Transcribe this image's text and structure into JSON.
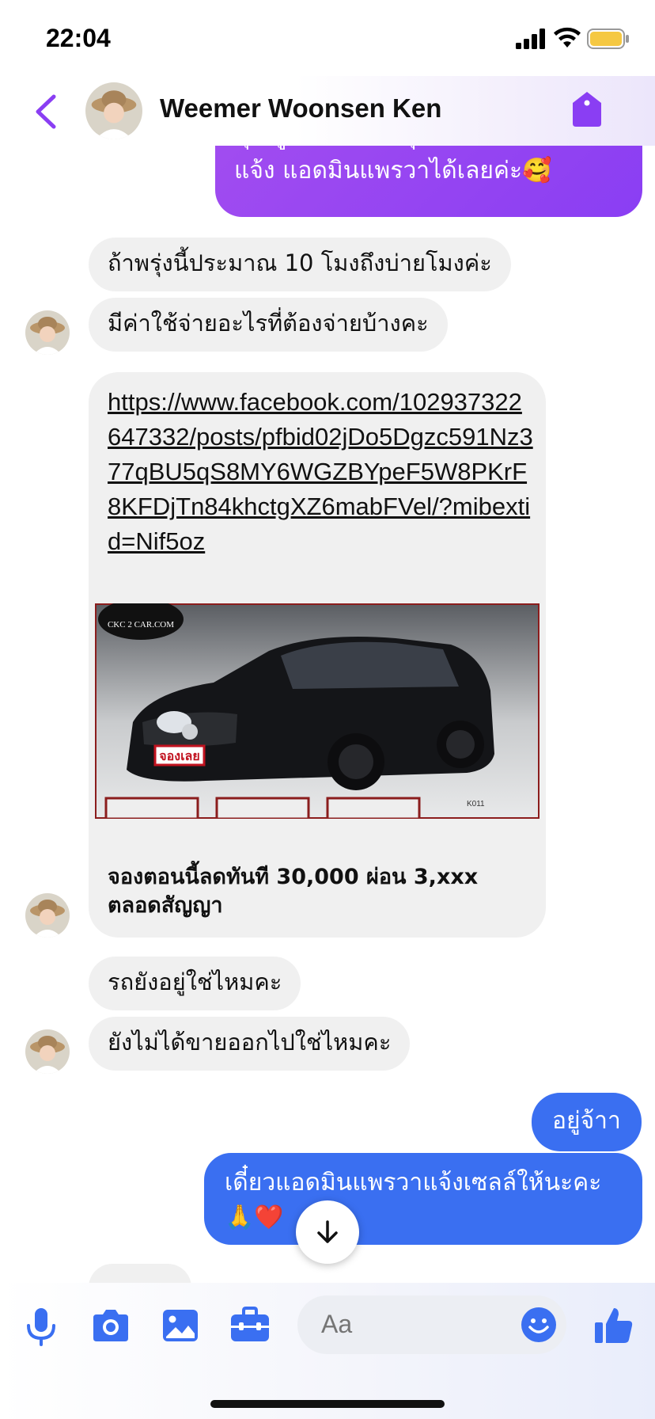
{
  "status_bar": {
    "time": "22:04"
  },
  "header": {
    "contact_name": "Weemer Woonsen Ken"
  },
  "messages": {
    "outgoing_1_line1": "คุณลูกค้าสะดวกคุยช่วงเวลาไหนคะ",
    "outgoing_1_line2": "แจ้ง แอดมินแพรวาได้เลยค่ะ🥰",
    "incoming_1": "ถ้าพรุ่งนี้ประมาณ 10 โมงถึงบ่ายโมงค่ะ",
    "incoming_2": "มีค่าใช้จ่ายอะไรที่ต้องจ่ายบ้างคะ",
    "link_url": "https://www.facebook.com/102937322647332/posts/pfbid02jDo5Dgzc591Nz377qBU5qS8MY6WGZBYpeF5W8PKrF8KFDjTn84khctgXZ6mabFVel/?mibextid=Nif5oz",
    "link_preview_caption": "จองตอนนี้ลดทันที 30,000 ผ่อน 3,xxx ตลอดสัญญา",
    "image_watermark": "CKC 2 CAR.COM",
    "image_badge": "จองเลย",
    "image_code": "K011",
    "incoming_3": "รถยังอยู่ใช่ไหมคะ",
    "incoming_4": "ยังไม่ได้ขายออกไปใช่ไหมคะ",
    "outgoing_2": "อยู่จ้าา",
    "outgoing_3_line1": "เดี๋ยวแอดมินแพรวาแจ้งเซลล์ให้นะคะ",
    "outgoing_3_line2": "🙏❤️"
  },
  "composer": {
    "placeholder": "Aa"
  },
  "colors": {
    "accent_purple": "#8a3ef3",
    "outgoing_blue": "#3a6ff1",
    "incoming_gray": "#f0f0f0",
    "icon_blue": "#3a6ff1"
  },
  "icons": [
    "back-chevron",
    "tag",
    "microphone",
    "camera",
    "gallery",
    "toolbox",
    "emoji",
    "thumbs-up",
    "arrow-down"
  ]
}
